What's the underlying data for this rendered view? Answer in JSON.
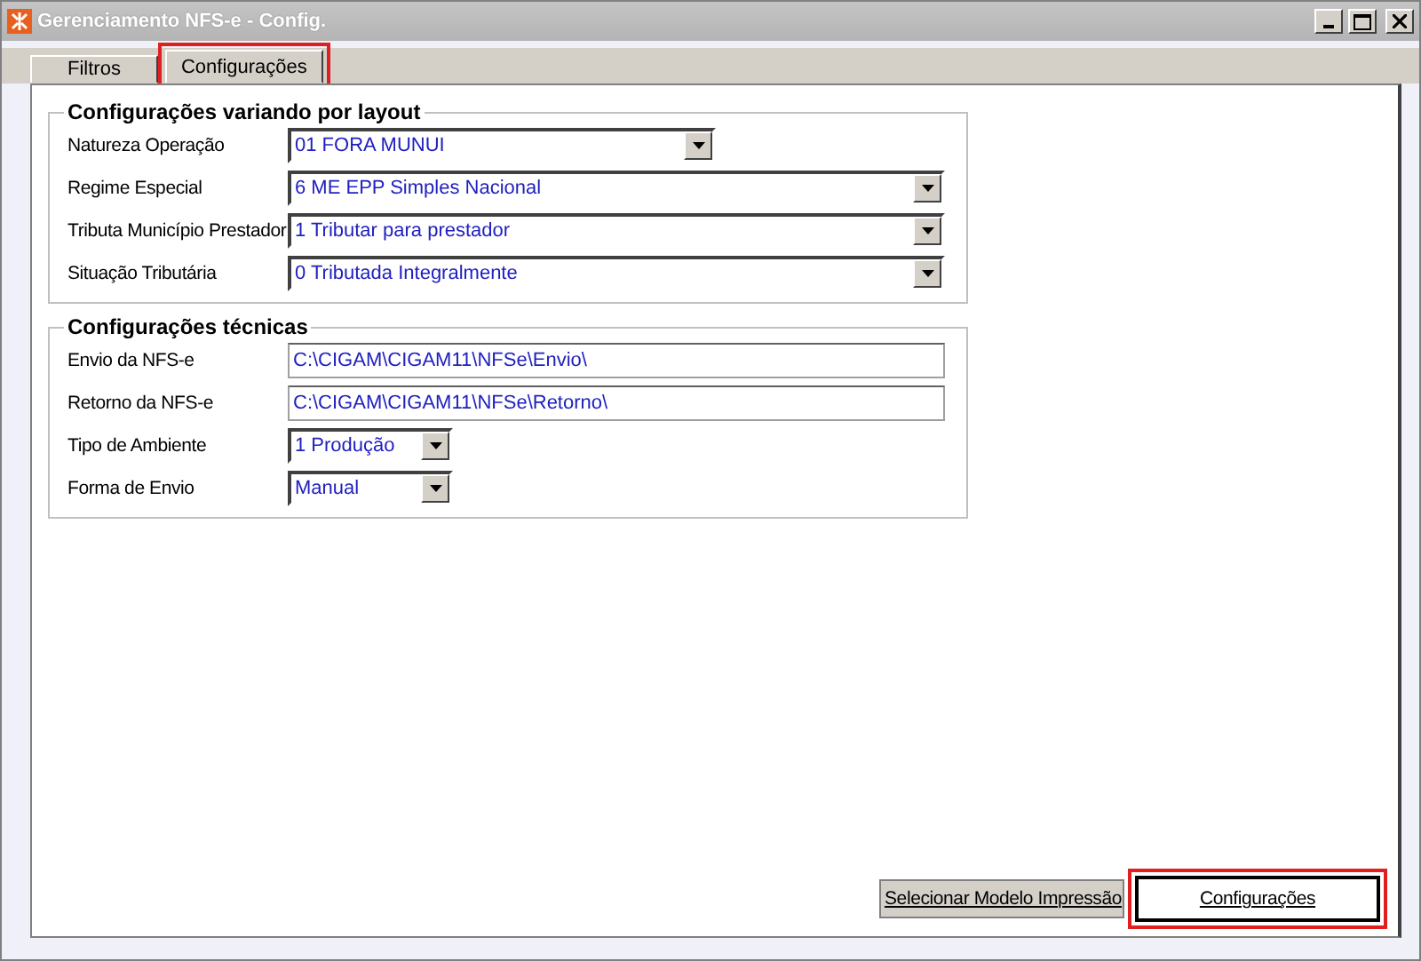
{
  "window": {
    "title": "Gerenciamento NFS-e - Config."
  },
  "tabs": [
    {
      "label": "Filtros",
      "selected": false,
      "highlighted": false
    },
    {
      "label": "Configurações",
      "selected": true,
      "highlighted": true
    }
  ],
  "groups": [
    {
      "title": "Configurações variando por layout",
      "fields": [
        {
          "label": "Natureza Operação",
          "kind": "combo",
          "value": "01 FORA MUNUI"
        },
        {
          "label": "Regime Especial",
          "kind": "combo",
          "value": "6 ME EPP Simples Nacional"
        },
        {
          "label": "Tributa Município Prestador",
          "kind": "combo",
          "value": "1 Tributar para prestador"
        },
        {
          "label": "Situação Tributária",
          "kind": "combo",
          "value": "0  Tributada Integralmente"
        }
      ]
    },
    {
      "title": "Configurações técnicas",
      "fields": [
        {
          "label": "Envio da NFS-e",
          "kind": "text",
          "value": "C:\\CIGAM\\CIGAM11\\NFSe\\Envio\\"
        },
        {
          "label": "Retorno da NFS-e",
          "kind": "text",
          "value": "C:\\CIGAM\\CIGAM11\\NFSe\\Retorno\\"
        },
        {
          "label": "Tipo de Ambiente",
          "kind": "combo",
          "value": "1 Produção"
        },
        {
          "label": "Forma de Envio",
          "kind": "combo",
          "value": "Manual"
        }
      ]
    }
  ],
  "buttons": [
    {
      "label": "Selecionar Modelo Impressão",
      "default": false,
      "highlighted": false
    },
    {
      "label": "Configurações",
      "default": true,
      "highlighted": true
    }
  ]
}
